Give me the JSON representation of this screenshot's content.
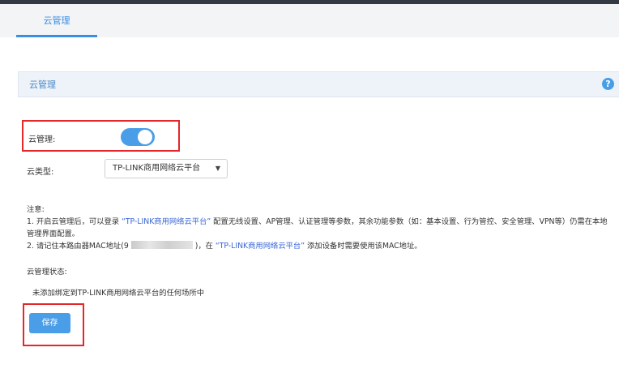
{
  "tabs": [
    {
      "label": "云管理"
    }
  ],
  "panel": {
    "title": "云管理",
    "help_icon": "question-circle-icon"
  },
  "form": {
    "cloud_mgmt_label": "云管理:",
    "cloud_mgmt_enabled": true,
    "cloud_type_label": "云类型:",
    "cloud_type_value": "TP-LINK商用网络云平台"
  },
  "notes": {
    "heading": "注意:",
    "line1_pre": "1. 开启云管理后，可以登录",
    "line1_link": "“TP-LINK商用网络云平台”",
    "line1_post": "配置无线设置、AP管理、认证管理等参数，其余功能参数（如：基本设置、行为管控、安全管理、VPN等）仍需在本地",
    "line1_cont": "管理界面配置。",
    "line2_pre": "2. 请记住本路由器MAC地址(",
    "line2_mac_partial": "9",
    "line2_mid": ")，在",
    "line2_link": "“TP-LINK商用网络云平台”",
    "line2_post": "添加设备时需要使用该MAC地址。"
  },
  "status": {
    "label": "云管理状态:",
    "value": "未添加绑定到TP-LINK商用网络云平台的任何场所中"
  },
  "save_label": "保存",
  "colors": {
    "accent": "#4a9ee8",
    "highlight": "#e5262a",
    "link": "#3a66d6"
  }
}
